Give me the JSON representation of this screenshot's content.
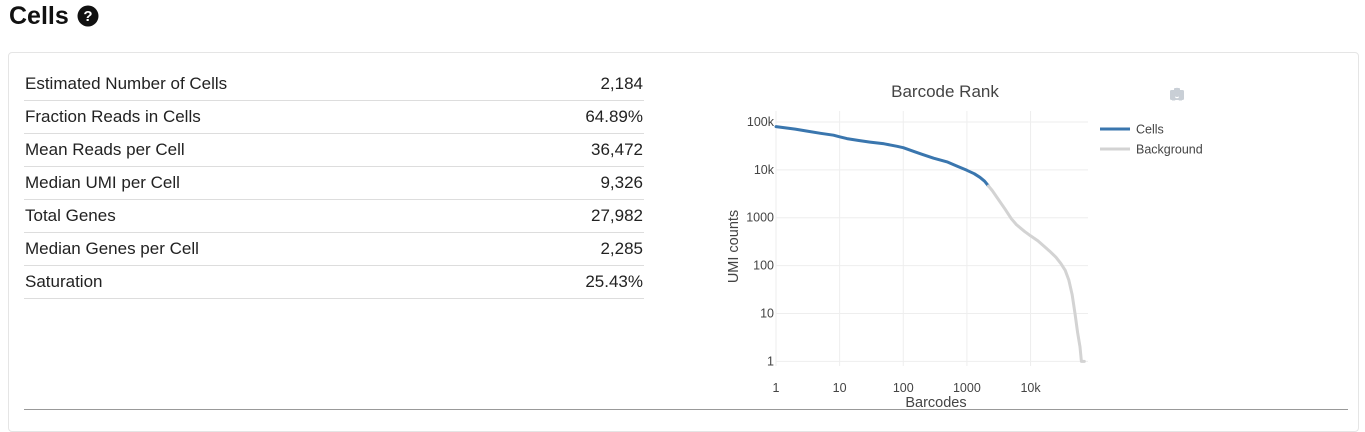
{
  "header": {
    "title": "Cells"
  },
  "metrics": [
    {
      "label": "Estimated Number of Cells",
      "value": "2,184"
    },
    {
      "label": "Fraction Reads in Cells",
      "value": "64.89%"
    },
    {
      "label": "Mean Reads per Cell",
      "value": "36,472"
    },
    {
      "label": "Median UMI per Cell",
      "value": "9,326"
    },
    {
      "label": "Total Genes",
      "value": "27,982"
    },
    {
      "label": "Median Genes per Cell",
      "value": "2,285"
    },
    {
      "label": "Saturation",
      "value": "25.43%"
    }
  ],
  "chart_data": {
    "type": "line",
    "title": "Barcode Rank",
    "xlabel": "Barcodes",
    "ylabel": "UMI counts",
    "x_scale": "log",
    "y_scale": "log",
    "xlim": [
      1,
      80000
    ],
    "ylim": [
      0.8,
      140000
    ],
    "x_ticks": [
      {
        "value": 1,
        "label": "1"
      },
      {
        "value": 10,
        "label": "10"
      },
      {
        "value": 100,
        "label": "100"
      },
      {
        "value": 1000,
        "label": "1000"
      },
      {
        "value": 10000,
        "label": "10k"
      }
    ],
    "y_ticks": [
      {
        "value": 1,
        "label": "1"
      },
      {
        "value": 10,
        "label": "10"
      },
      {
        "value": 100,
        "label": "100"
      },
      {
        "value": 1000,
        "label": "1000"
      },
      {
        "value": 10000,
        "label": "10k"
      },
      {
        "value": 100000,
        "label": "100k"
      }
    ],
    "grid": true,
    "legend_position": "right",
    "series": [
      {
        "name": "Cells",
        "color": "#3a76ae",
        "points": [
          [
            1,
            80000
          ],
          [
            2,
            71000
          ],
          [
            3,
            65000
          ],
          [
            5,
            58000
          ],
          [
            8,
            53000
          ],
          [
            10,
            49000
          ],
          [
            13,
            45000
          ],
          [
            20,
            41000
          ],
          [
            30,
            38000
          ],
          [
            50,
            35000
          ],
          [
            80,
            31000
          ],
          [
            100,
            29000
          ],
          [
            150,
            24000
          ],
          [
            200,
            21000
          ],
          [
            300,
            17500
          ],
          [
            500,
            14500
          ],
          [
            700,
            12000
          ],
          [
            1000,
            9800
          ],
          [
            1300,
            8300
          ],
          [
            1600,
            7000
          ],
          [
            1900,
            5800
          ],
          [
            2184,
            4600
          ]
        ]
      },
      {
        "name": "Background",
        "color": "#d3d3d3",
        "points": [
          [
            2184,
            4600
          ],
          [
            2500,
            3700
          ],
          [
            3000,
            2600
          ],
          [
            4000,
            1500
          ],
          [
            5000,
            950
          ],
          [
            6000,
            720
          ],
          [
            8000,
            520
          ],
          [
            10000,
            420
          ],
          [
            13000,
            330
          ],
          [
            16000,
            260
          ],
          [
            20000,
            200
          ],
          [
            25000,
            150
          ],
          [
            30000,
            110
          ],
          [
            35000,
            80
          ],
          [
            40000,
            50
          ],
          [
            45000,
            25
          ],
          [
            50000,
            10
          ],
          [
            55000,
            4
          ],
          [
            60000,
            2
          ],
          [
            63000,
            1
          ],
          [
            70000,
            1
          ]
        ]
      }
    ]
  },
  "icons": {
    "help": "question-circle-icon",
    "camera": "camera-icon",
    "home": "home-icon"
  }
}
